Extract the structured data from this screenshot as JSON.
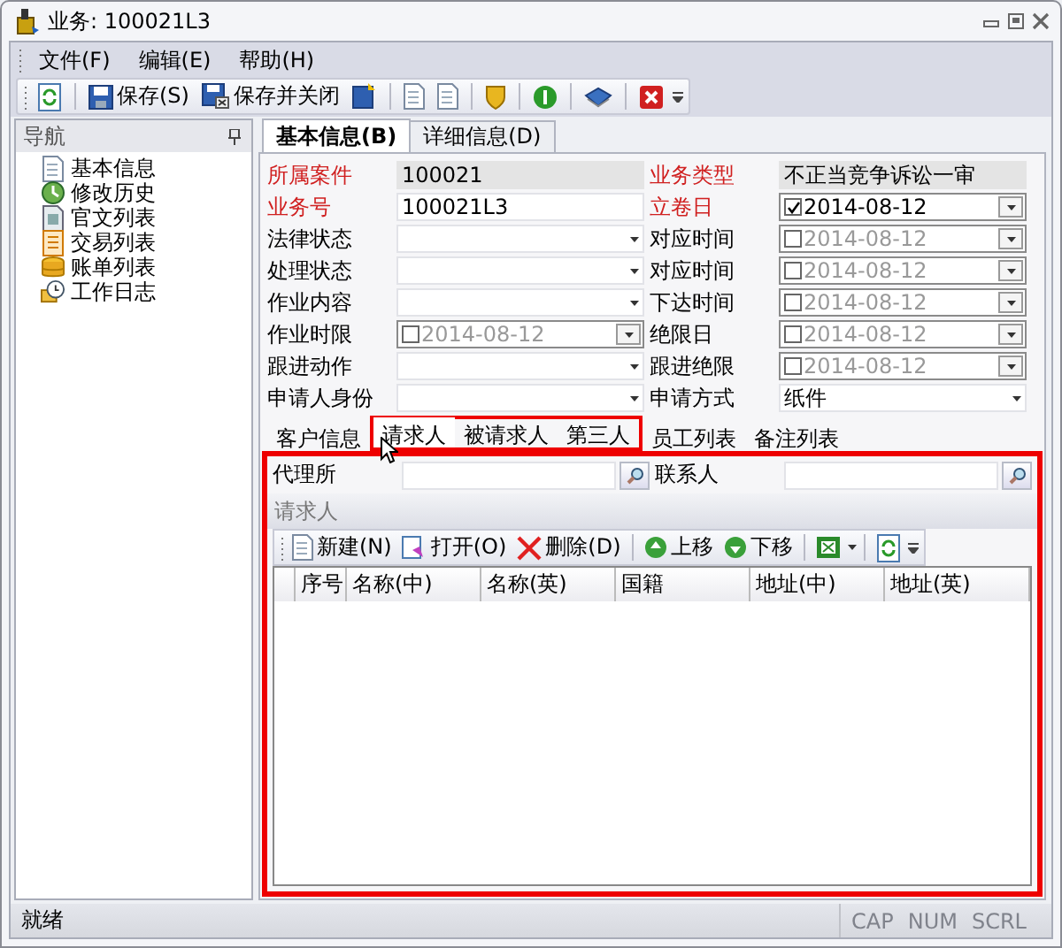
{
  "window": {
    "title": "业务: 100021L3"
  },
  "menu": [
    "文件(F)",
    "编辑(E)",
    "帮助(H)"
  ],
  "toolbar": {
    "buttons": [
      "保存(S)",
      "保存并关闭"
    ]
  },
  "nav": {
    "title": "导航",
    "items": [
      "基本信息",
      "修改历史",
      "官文列表",
      "交易列表",
      "账单列表",
      "工作日志"
    ]
  },
  "main_tabs": [
    {
      "label": "基本信息(B)",
      "selected": true
    },
    {
      "label": "详细信息(D)",
      "selected": false
    }
  ],
  "form": {
    "rows": [
      [
        {
          "label": "所属案件",
          "required": true,
          "kind": "readonly",
          "value": "100021"
        },
        {
          "label": "业务类型",
          "required": true,
          "kind": "readonly",
          "value": "不正当竞争诉讼一审"
        }
      ],
      [
        {
          "label": "业务号",
          "required": true,
          "kind": "text",
          "value": "100021L3"
        },
        {
          "label": "立卷日",
          "required": true,
          "kind": "date",
          "checked": true,
          "value": "2014-08-12"
        }
      ],
      [
        {
          "label": "法律状态",
          "required": false,
          "kind": "combo"
        },
        {
          "label": "对应时间",
          "required": false,
          "kind": "date",
          "checked": false,
          "value": "2014-08-12"
        }
      ],
      [
        {
          "label": "处理状态",
          "required": false,
          "kind": "combo"
        },
        {
          "label": "对应时间",
          "required": false,
          "kind": "date",
          "checked": false,
          "value": "2014-08-12"
        }
      ],
      [
        {
          "label": "作业内容",
          "required": false,
          "kind": "combo"
        },
        {
          "label": "下达时间",
          "required": false,
          "kind": "date",
          "checked": false,
          "value": "2014-08-12"
        }
      ],
      [
        {
          "label": "作业时限",
          "required": false,
          "kind": "date",
          "checked": false,
          "value": "2014-08-12"
        },
        {
          "label": "绝限日",
          "required": false,
          "kind": "date",
          "checked": false,
          "value": "2014-08-12"
        }
      ],
      [
        {
          "label": "跟进动作",
          "required": false,
          "kind": "combo"
        },
        {
          "label": "跟进绝限",
          "required": false,
          "kind": "date",
          "checked": false,
          "value": "2014-08-12"
        }
      ],
      [
        {
          "label": "申请人身份",
          "required": false,
          "kind": "combo"
        },
        {
          "label": "申请方式",
          "required": false,
          "kind": "combo",
          "value": "纸件"
        }
      ]
    ]
  },
  "sub_tabs": [
    {
      "label": "客户信息",
      "selected": false,
      "highlighted": false
    },
    {
      "label": "请求人",
      "selected": true,
      "highlighted": true
    },
    {
      "label": "被请求人",
      "selected": false,
      "highlighted": true
    },
    {
      "label": "第三人",
      "selected": false,
      "highlighted": true
    },
    {
      "label": "员工列表",
      "selected": false,
      "highlighted": false
    },
    {
      "label": "备注列表",
      "selected": false,
      "highlighted": false
    }
  ],
  "panel": {
    "highlighted": true,
    "lookups": [
      {
        "label": "代理所"
      },
      {
        "label": "联系人"
      }
    ],
    "group_title": "请求人",
    "toolbar": [
      "新建(N)",
      "打开(O)",
      "删除(D)",
      "上移",
      "下移"
    ],
    "table": {
      "columns": [
        "序号",
        "名称(中)",
        "名称(英)",
        "国籍",
        "地址(中)",
        "地址(英)"
      ]
    }
  },
  "status_bar": {
    "text": "就绪",
    "indicators": [
      {
        "label": "CAP",
        "active": false
      },
      {
        "label": "NUM",
        "active": false
      },
      {
        "label": "SCRL",
        "active": false
      }
    ]
  }
}
